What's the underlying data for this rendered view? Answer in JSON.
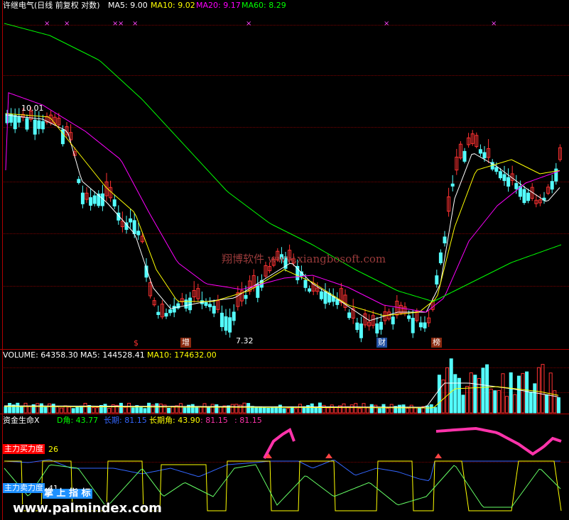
{
  "price_panel": {
    "title": "许继电气(日线 前复权 对数)",
    "ma_legend": [
      {
        "label": "MA5: 9.00",
        "color": "#ffffff"
      },
      {
        "label": "MA10: 9.02",
        "color": "#ffff00"
      },
      {
        "label": "MA20: 9.17",
        "color": "#ff00ff"
      },
      {
        "label": "MA60: 8.29",
        "color": "#00ff00"
      }
    ],
    "high_label": "10.01",
    "low_label": "7.32",
    "watermark": "翔博软件 www.xiangbosoft.com",
    "event_markers": [
      {
        "text": "$",
        "color": "#ff3333"
      },
      {
        "text": "增",
        "color": "#ffffff"
      },
      {
        "text": "财",
        "color": "#ffffff"
      },
      {
        "text": "榜",
        "color": "#ffffff"
      }
    ],
    "colors": {
      "up": "#ff3232",
      "down": "#54ffff",
      "ma5": "#ffffff",
      "ma10": "#ffff00",
      "ma20": "#ff00ff",
      "ma60": "#00ff00"
    }
  },
  "volume_panel": {
    "legend": [
      {
        "label": "VOLUME: 64358.30",
        "color": "#ffffff"
      },
      {
        "label": "MA5: 144528.41",
        "color": "#ffffff"
      },
      {
        "label": "MA10: 174632.00",
        "color": "#ffff00"
      }
    ]
  },
  "indicator_panel": {
    "name": "资金生命X",
    "legend": [
      {
        "label": "D角: 43.77",
        "color": "#00ff00"
      },
      {
        "label": "长期: 81.15",
        "color": "#3366ff"
      },
      {
        "label": "长期角: 43.90",
        "color": "#ffff00"
      },
      {
        "label": ": 81.15",
        "color": "#ff33aa"
      },
      {
        "label": ": 81.15",
        "color": "#ff33aa"
      }
    ],
    "main_buy_label": "主力买力度",
    "main_buy_value": "26",
    "main_sell_label": "主力卖力度",
    "main_sell_value": "41",
    "badge_text": "掌 上 指 标"
  },
  "footer_watermark": "www.palmindex.com"
}
